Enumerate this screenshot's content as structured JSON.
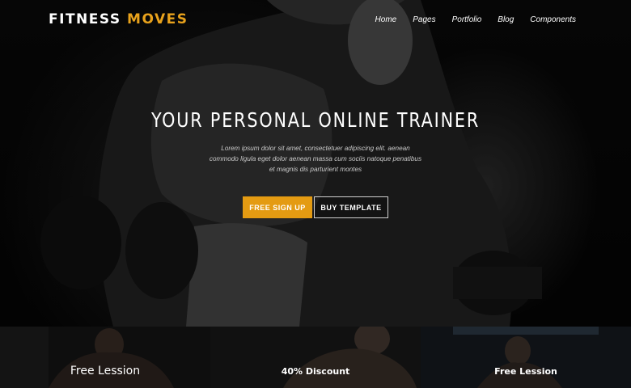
{
  "brand": {
    "part1": "FITNESS ",
    "part2": "MOVES",
    "accent_color": "#e8a21c"
  },
  "nav": {
    "items": [
      {
        "label": "Home"
      },
      {
        "label": "Pages"
      },
      {
        "label": "Portfolio"
      },
      {
        "label": "Blog"
      },
      {
        "label": "Components"
      }
    ]
  },
  "hero": {
    "title": "YOUR PERSONAL ONLINE TRAINER",
    "description": "Lorem ipsum dolor sit amet, consectetuer adipiscing elit. aenean commodo ligula eget dolor aenean massa cum sociis natoque penatibus et magnis dis parturient montes",
    "primary_button": "FREE SIGN UP",
    "secondary_button": "BUY TEMPLATE",
    "primary_color": "#e49b12"
  },
  "cards": [
    {
      "title": "Free Lession"
    },
    {
      "title": "40% Discount"
    },
    {
      "title": "Free Lession"
    }
  ]
}
